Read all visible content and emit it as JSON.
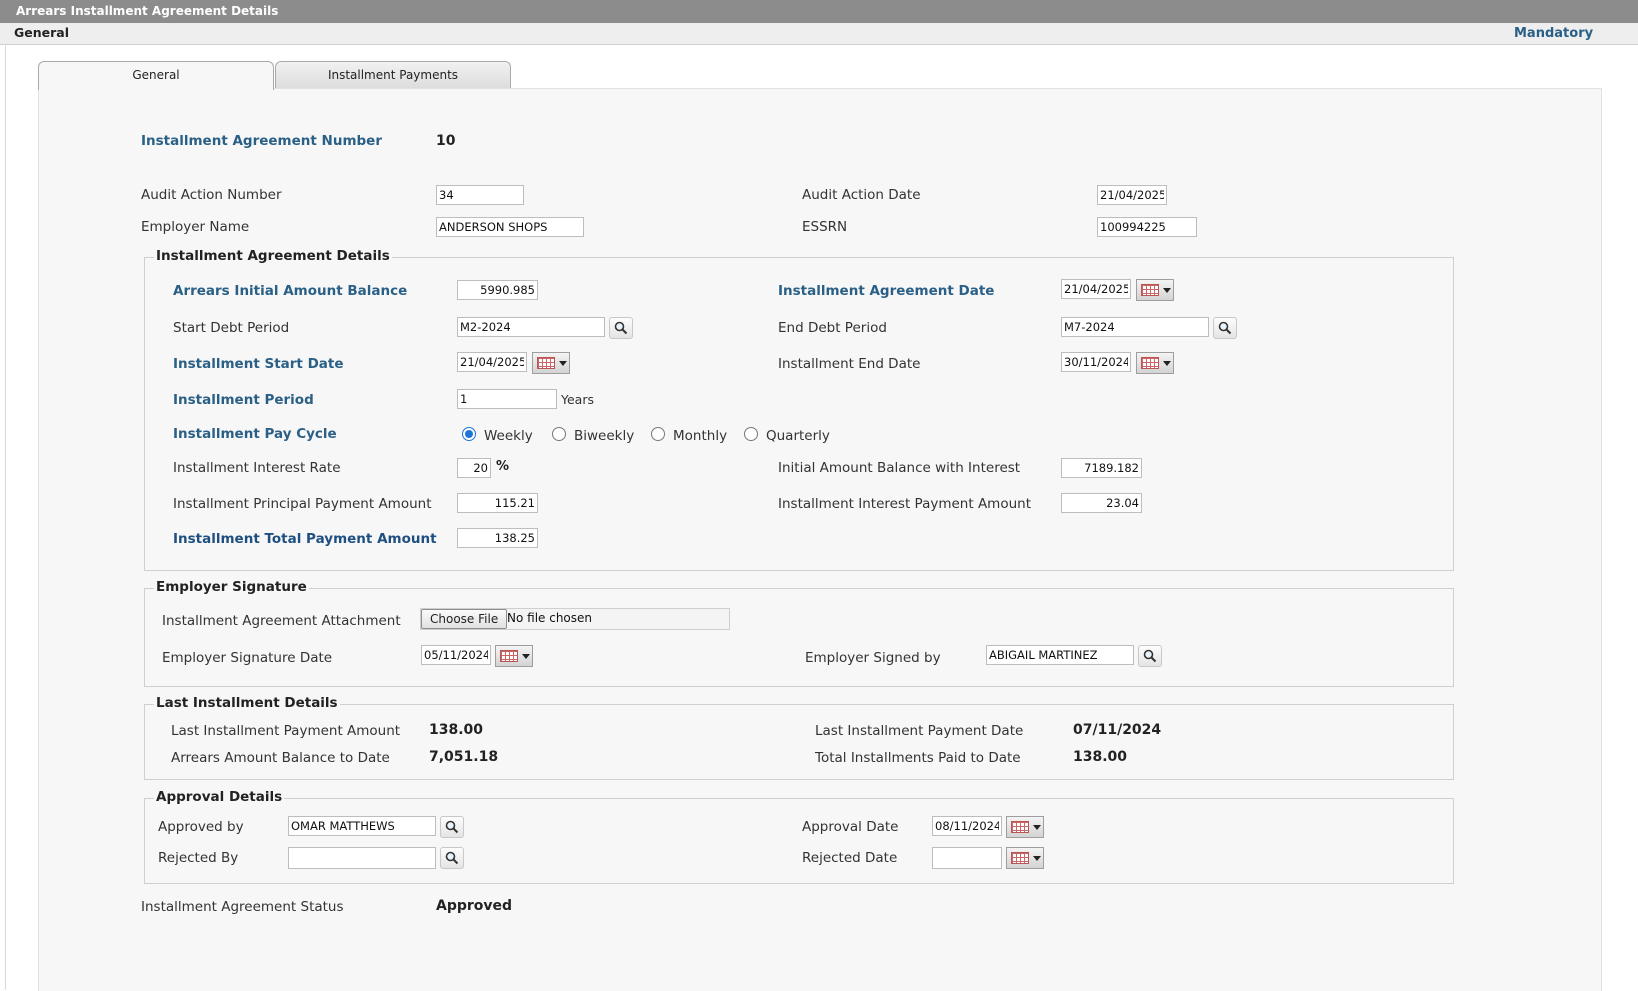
{
  "window": {
    "title": "Arrears Installment Agreement Details"
  },
  "subheader": {
    "section": "General",
    "mandatory": "Mandatory"
  },
  "tabs": [
    {
      "label": "General"
    },
    {
      "label": "Installment Payments"
    }
  ],
  "header_fields": {
    "agreement_number_label": "Installment Agreement Number",
    "agreement_number": "10",
    "audit_action_number_label": "Audit Action Number",
    "audit_action_number": "34",
    "audit_action_date_label": "Audit Action Date",
    "audit_action_date": "21/04/2025",
    "employer_name_label": "Employer Name",
    "employer_name": "ANDERSON SHOPS",
    "essrn_label": "ESSRN",
    "essrn": "100994225"
  },
  "agreement_details": {
    "legend": "Installment Agreement Details",
    "arrears_initial_label": "Arrears Initial Amount Balance",
    "arrears_initial": "5990.985",
    "agreement_date_label": "Installment Agreement Date",
    "agreement_date": "21/04/2025",
    "start_debt_label": "Start Debt Period",
    "start_debt": "M2-2024",
    "end_debt_label": "End Debt Period",
    "end_debt": "M7-2024",
    "start_date_label": "Installment Start Date",
    "start_date": "21/04/2025",
    "end_date_label": "Installment End Date",
    "end_date": "30/11/2024",
    "period_label": "Installment Period",
    "period": "1",
    "period_unit": "Years",
    "pay_cycle_label": "Installment Pay Cycle",
    "pay_cycle_options": [
      "Weekly",
      "Biweekly",
      "Monthly",
      "Quarterly"
    ],
    "pay_cycle_selected": "Weekly",
    "interest_rate_label": "Installment Interest Rate",
    "interest_rate": "20",
    "percent": "%",
    "initial_with_interest_label": "Initial Amount Balance with Interest",
    "initial_with_interest": "7189.182",
    "principal_label": "Installment Principal Payment Amount",
    "principal": "115.21",
    "interest_payment_label": "Installment Interest Payment Amount",
    "interest_payment": "23.04",
    "total_label": "Installment Total Payment Amount",
    "total": "138.25"
  },
  "employer_signature": {
    "legend": "Employer Signature",
    "attachment_label": "Installment Agreement Attachment",
    "choose_file": "Choose File",
    "no_file": "No file chosen",
    "signature_date_label": "Employer Signature Date",
    "signature_date": "05/11/2024",
    "signed_by_label": "Employer Signed by",
    "signed_by": "ABIGAIL MARTINEZ"
  },
  "last_installment": {
    "legend": "Last Installment Details",
    "last_amount_label": "Last Installment Payment Amount",
    "last_amount": "138.00",
    "last_date_label": "Last Installment Payment Date",
    "last_date": "07/11/2024",
    "balance_label": "Arrears Amount Balance to Date",
    "balance": "7,051.18",
    "total_paid_label": "Total Installments Paid to Date",
    "total_paid": "138.00"
  },
  "approval": {
    "legend": "Approval Details",
    "approved_by_label": "Approved by",
    "approved_by": "OMAR MATTHEWS",
    "approval_date_label": "Approval Date",
    "approval_date": "08/11/2024",
    "rejected_by_label": "Rejected By",
    "rejected_by": "",
    "rejected_date_label": "Rejected Date",
    "rejected_date": ""
  },
  "status": {
    "label": "Installment Agreement Status",
    "value": "Approved"
  },
  "colors": {
    "label_blue": "#2a5f86",
    "titlebar": "#8c8c8c",
    "radio_selected": "#1e74d6"
  }
}
